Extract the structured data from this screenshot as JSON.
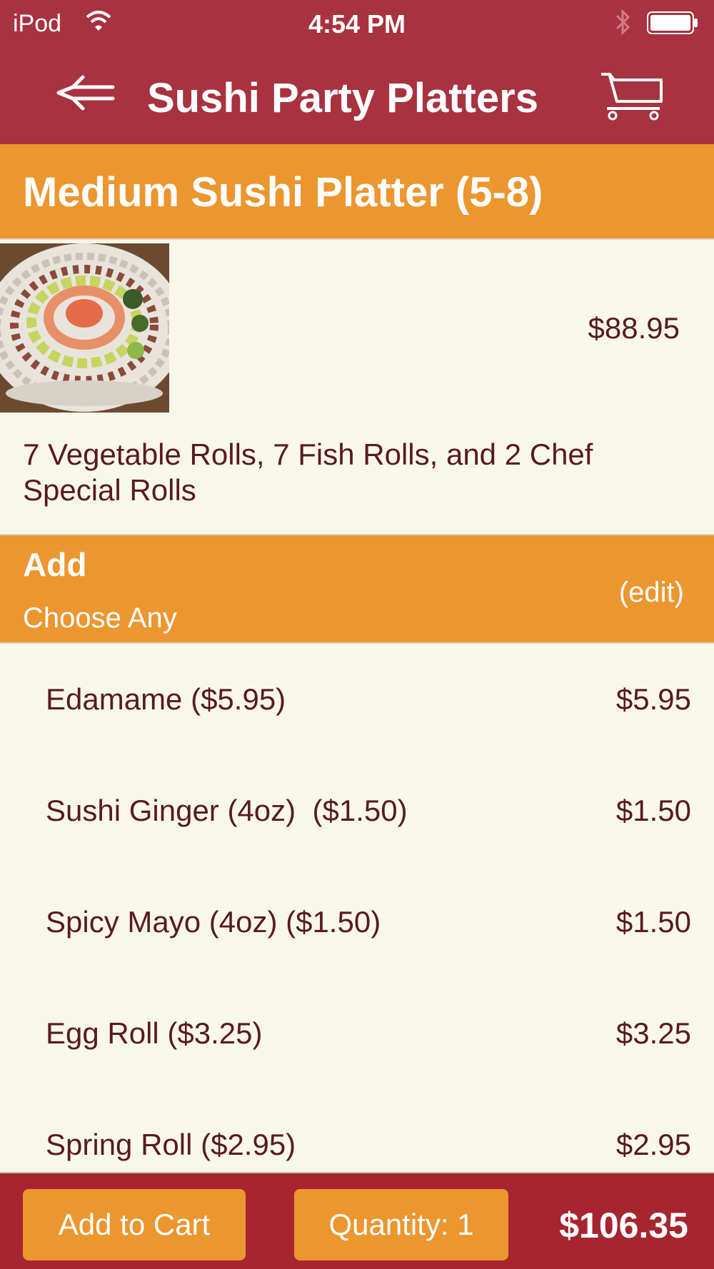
{
  "status_bar": {
    "carrier": "iPod",
    "time": "4:54 PM"
  },
  "nav": {
    "title": "Sushi Party Platters",
    "back_icon": "back-arrow-icon",
    "cart_icon": "cart-icon"
  },
  "product": {
    "name": "Medium Sushi Platter (5-8)",
    "price": "$88.95",
    "description": "7 Vegetable Rolls, 7 Fish Rolls, and 2 Chef Special Rolls"
  },
  "addons": {
    "title": "Add",
    "subtitle": "Choose Any",
    "edit_label": "(edit)",
    "options": [
      {
        "label": "Edamame ($5.95)",
        "price": "$5.95"
      },
      {
        "label": "Sushi Ginger (4oz)  ($1.50)",
        "price": "$1.50"
      },
      {
        "label": "Spicy Mayo (4oz) ($1.50)",
        "price": "$1.50"
      },
      {
        "label": "Egg Roll ($3.25)",
        "price": "$3.25"
      },
      {
        "label": "Spring Roll ($2.95)",
        "price": "$2.95"
      }
    ]
  },
  "footer": {
    "add_to_cart": "Add to Cart",
    "quantity": "Quantity: 1",
    "total": "$106.35"
  },
  "colors": {
    "header_red": "#a83240",
    "orange": "#ec962f",
    "background": "#f8f8ea",
    "text_dark": "#5a1a1e"
  }
}
